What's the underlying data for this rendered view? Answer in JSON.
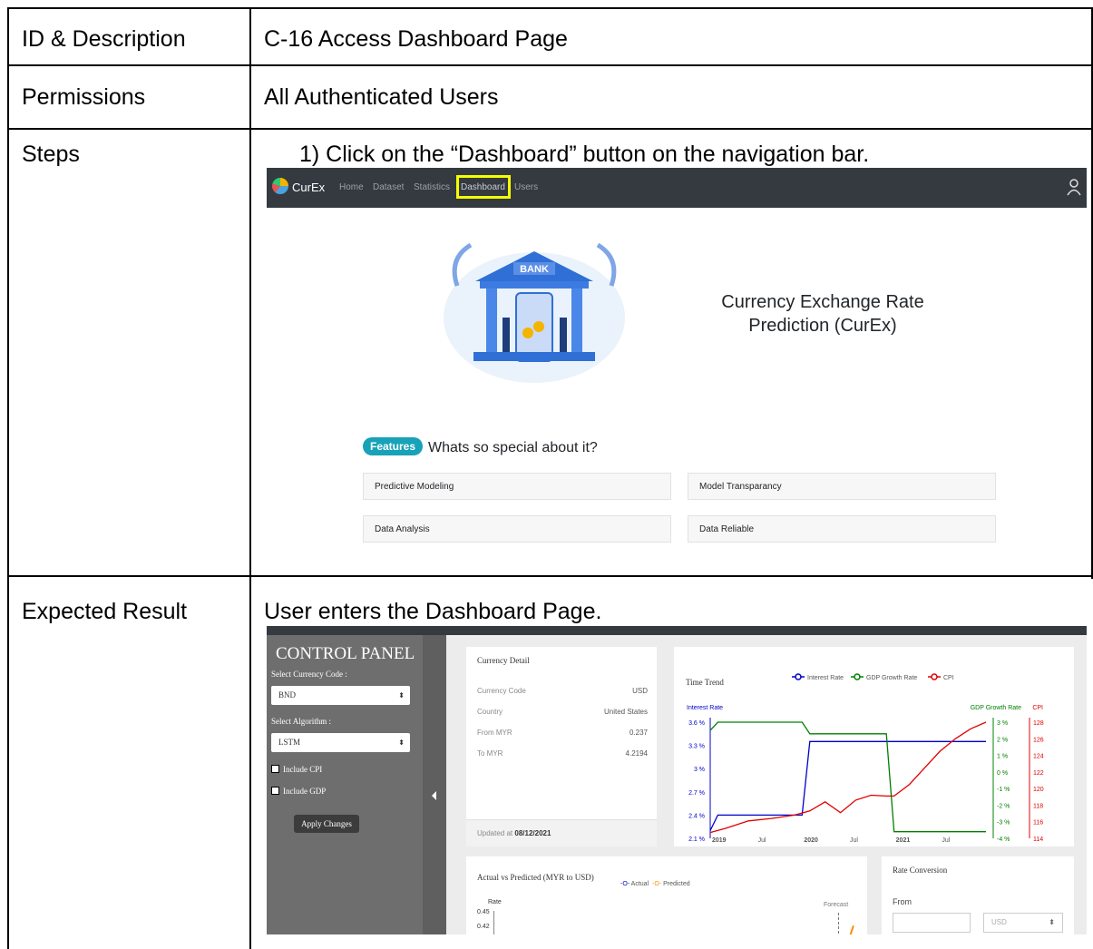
{
  "rows": [
    {
      "label": "ID & Description",
      "value": "C-16 Access Dashboard Page"
    },
    {
      "label": "Permissions",
      "value": "All Authenticated Users"
    },
    {
      "label": "Steps",
      "value": "1)  Click on the “Dashboard” button on the navigation bar."
    },
    {
      "label": "Expected Result",
      "value": "User enters the Dashboard Page."
    }
  ],
  "nav": {
    "brand": "CurEx",
    "items": [
      "Home",
      "Dataset",
      "Statistics",
      "Dashboard",
      "Users"
    ],
    "highlight_color": "#f5ff00"
  },
  "landing": {
    "bank_sign": "BANK",
    "title_line1": "Currency Exchange Rate",
    "title_line2": "Prediction (CurEx)",
    "features_pill": "Features",
    "features_heading": "Whats so special about it?",
    "features": [
      "Predictive Modeling",
      "Model Transparancy",
      "Data Analysis",
      "Data Reliable"
    ]
  },
  "dashboard": {
    "control_panel": {
      "title": "CONTROL PANEL",
      "currency_label": "Select Currency Code :",
      "currency_value": "BND",
      "algorithm_label": "Select Algorithm :",
      "algorithm_value": "LSTM",
      "include_cpi": "Include CPI",
      "include_gdp": "Include GDP",
      "apply": "Apply Changes"
    },
    "currency_detail": {
      "title": "Currency Detail",
      "rows": [
        {
          "k": "Currency Code",
          "v": "USD"
        },
        {
          "k": "Country",
          "v": "United States"
        },
        {
          "k": "From MYR",
          "v": "0.237"
        },
        {
          "k": "To MYR",
          "v": "4.2194"
        }
      ],
      "updated_prefix": "Updated at ",
      "updated_date": "08/12/2021"
    },
    "actual_vs_predicted": {
      "title": "Actual vs Predicted (MYR to USD)",
      "legend_actual": "Actual",
      "legend_predicted": "Predicted",
      "y_title": "Rate",
      "ticks": [
        "0.45",
        "0.42"
      ],
      "forecast": "Forecast"
    },
    "rate_conversion": {
      "title": "Rate Conversion",
      "from_label": "From",
      "currency": "USD"
    }
  },
  "chart_data": {
    "type": "line",
    "title": "Time Trend",
    "x_ticks": [
      "2019",
      "Jul",
      "2020",
      "Jul",
      "2021",
      "Jul"
    ],
    "xlim": [
      0,
      36
    ],
    "legend": [
      "Interest Rate",
      "GDP Growth Rate",
      "CPI"
    ],
    "axes": {
      "interest": {
        "label": "Interest Rate",
        "ticks": [
          "3.6 %",
          "3.3 %",
          "3 %",
          "2.7 %",
          "2.4 %",
          "2.1 %"
        ],
        "range": [
          2.1,
          3.6
        ],
        "color": "#0000cc"
      },
      "gdp": {
        "label": "GDP Growth Rate",
        "ticks": [
          "3 %",
          "2 %",
          "1 %",
          "0 %",
          "-1 %",
          "-2 %",
          "-3 %",
          "-4 %"
        ],
        "range": [
          -4,
          3
        ],
        "color": "#008000"
      },
      "cpi": {
        "label": "CPI",
        "ticks": [
          "128",
          "126",
          "124",
          "122",
          "120",
          "118",
          "116",
          "114"
        ],
        "range": [
          114,
          128
        ],
        "color": "#e00000"
      }
    },
    "series": [
      {
        "name": "Interest Rate",
        "axis": "interest",
        "color": "#0000cc",
        "points": [
          [
            0,
            2.2
          ],
          [
            1,
            2.4
          ],
          [
            10,
            2.4
          ],
          [
            12,
            2.4
          ],
          [
            13,
            3.35
          ],
          [
            24,
            3.35
          ],
          [
            36,
            3.35
          ]
        ]
      },
      {
        "name": "GDP Growth Rate",
        "axis": "gdp",
        "color": "#008000",
        "points": [
          [
            0,
            2.5
          ],
          [
            1,
            3.0
          ],
          [
            12,
            3.0
          ],
          [
            13,
            2.3
          ],
          [
            23,
            2.3
          ],
          [
            24,
            -3.6
          ],
          [
            36,
            -3.6
          ]
        ]
      },
      {
        "name": "CPI",
        "axis": "cpi",
        "color": "#e00000",
        "points": [
          [
            0,
            114.7
          ],
          [
            2,
            115.2
          ],
          [
            5,
            116.1
          ],
          [
            8,
            116.4
          ],
          [
            11,
            116.8
          ],
          [
            13,
            117.3
          ],
          [
            15,
            118.4
          ],
          [
            17,
            117.1
          ],
          [
            19,
            118.6
          ],
          [
            21,
            119.2
          ],
          [
            23,
            119.1
          ],
          [
            24,
            119.1
          ],
          [
            26,
            120.5
          ],
          [
            28,
            122.5
          ],
          [
            30,
            124.5
          ],
          [
            32,
            126.0
          ],
          [
            34,
            127.2
          ],
          [
            36,
            128.0
          ]
        ]
      }
    ]
  }
}
